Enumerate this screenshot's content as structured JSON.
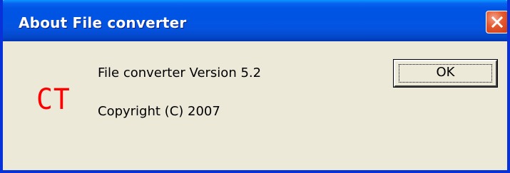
{
  "window": {
    "title": "About File converter"
  },
  "logo": {
    "text": "CT",
    "color": "#ff0000"
  },
  "info": {
    "version": "File converter Version 5.2",
    "copyright": "Copyright (C) 2007"
  },
  "buttons": {
    "ok_label": "OK"
  },
  "icons": {
    "close": "close-icon"
  },
  "colors": {
    "titlebar": "#0054e3",
    "close_button": "#e3582d",
    "client_background": "#ece9d8"
  }
}
